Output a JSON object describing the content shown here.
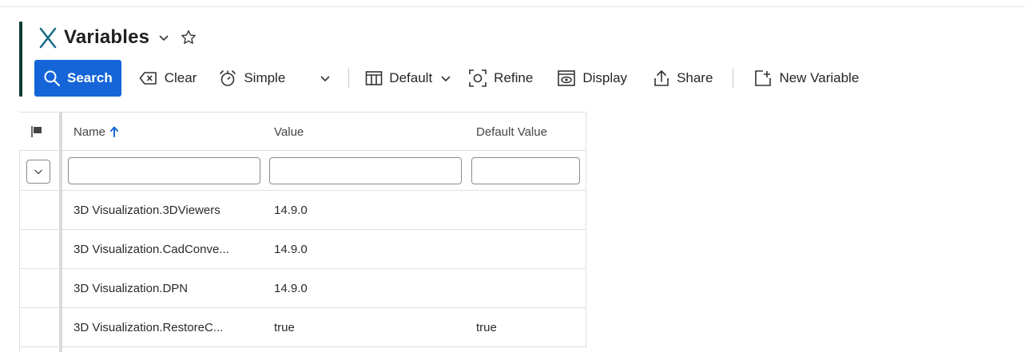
{
  "header": {
    "title": "Variables"
  },
  "toolbar": {
    "search_label": "Search",
    "clear_label": "Clear",
    "simple_label": "Simple",
    "default_label": "Default",
    "refine_label": "Refine",
    "display_label": "Display",
    "share_label": "Share",
    "new_variable_label": "New Variable"
  },
  "table": {
    "columns": {
      "name": "Name",
      "value": "Value",
      "default_value": "Default Value"
    },
    "sort": {
      "column": "Name",
      "direction": "ascending"
    },
    "filters": {
      "name": "",
      "value": "",
      "default_value": ""
    },
    "rows": [
      {
        "name": "3D Visualization.3DViewers",
        "value": "14.9.0",
        "default_value": ""
      },
      {
        "name": "3D Visualization.CadConve...",
        "value": "14.9.0",
        "default_value": ""
      },
      {
        "name": "3D Visualization.DPN",
        "value": "14.9.0",
        "default_value": ""
      },
      {
        "name": "3D Visualization.RestoreC...",
        "value": "true",
        "default_value": "true"
      }
    ]
  },
  "colors": {
    "primary": "#1565d8",
    "accent_bar": "#0e3b36",
    "title_icon": "#1b6d8a",
    "border": "#e0e0e0"
  },
  "icons": {
    "title": "variable-x-icon",
    "search": "search-icon",
    "clear": "backspace-clear-icon",
    "simple": "timer-icon",
    "default": "columns-icon",
    "refine": "refine-icon",
    "display": "display-icon",
    "share": "share-icon",
    "new": "add-icon"
  }
}
